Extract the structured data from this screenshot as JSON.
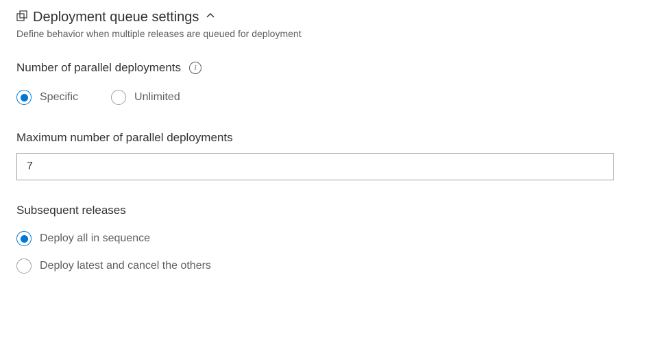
{
  "header": {
    "title": "Deployment queue settings",
    "subtitle": "Define behavior when multiple releases are queued for deployment"
  },
  "parallel_count": {
    "label": "Number of parallel deployments",
    "options": {
      "specific": "Specific",
      "unlimited": "Unlimited"
    },
    "selected": "specific"
  },
  "max_parallel": {
    "label": "Maximum number of parallel deployments",
    "value": "7"
  },
  "subsequent": {
    "label": "Subsequent releases",
    "options": {
      "sequence": "Deploy all in sequence",
      "latest": "Deploy latest and cancel the others"
    },
    "selected": "sequence"
  }
}
